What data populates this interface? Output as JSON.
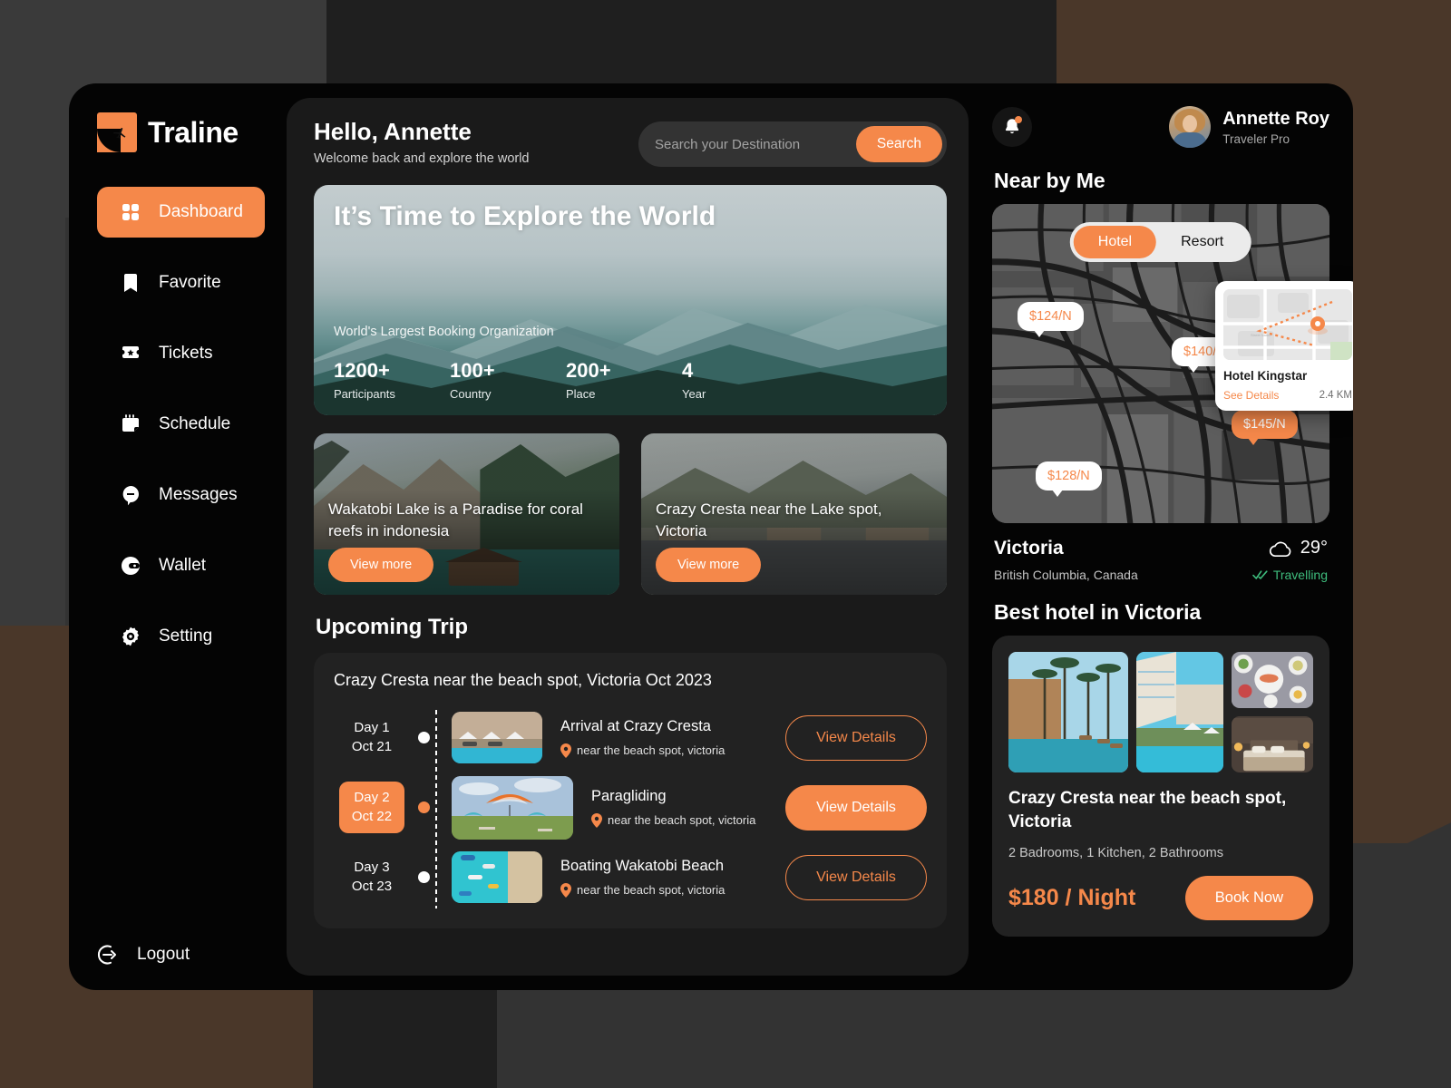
{
  "brand": {
    "name": "Traline",
    "logo_icon": "plane-logo-icon"
  },
  "sidebar": {
    "items": [
      {
        "label": "Dashboard",
        "icon": "grid-icon",
        "active": true
      },
      {
        "label": "Favorite",
        "icon": "bookmark-icon",
        "active": false
      },
      {
        "label": "Tickets",
        "icon": "ticket-star-icon",
        "active": false
      },
      {
        "label": "Schedule",
        "icon": "calendar-icon",
        "active": false
      },
      {
        "label": "Messages",
        "icon": "chat-bubble-icon",
        "active": false
      },
      {
        "label": "Wallet",
        "icon": "wallet-icon",
        "active": false
      },
      {
        "label": "Setting",
        "icon": "gear-icon",
        "active": false
      }
    ],
    "logout": {
      "label": "Logout",
      "icon": "power-icon"
    }
  },
  "header": {
    "greeting": "Hello, Annette",
    "subtitle": "Welcome back and explore the world",
    "search_placeholder": "Search your Destination",
    "search_value": "",
    "search_button": "Search"
  },
  "hero": {
    "title": "It’s Time to Explore the World",
    "subtitle": "World's Largest Booking Organization",
    "stats": [
      {
        "value": "1200+",
        "label": "Participants"
      },
      {
        "value": "100+",
        "label": "Country"
      },
      {
        "value": "200+",
        "label": "Place"
      },
      {
        "value": "4",
        "label": "Year"
      }
    ]
  },
  "destinations": [
    {
      "title": "Wakatobi Lake is a Paradise for coral reefs in indonesia",
      "button": "View more"
    },
    {
      "title": "Crazy Cresta near the Lake spot, Victoria",
      "button": "View more"
    }
  ],
  "upcoming": {
    "section_title": "Upcoming Trip",
    "trip_title": "Crazy Cresta near the beach spot, Victoria Oct 2023",
    "rows": [
      {
        "day": "Day 1",
        "date": "Oct 21",
        "active": false,
        "name": "Arrival at Crazy Cresta",
        "location": "near the beach spot, victoria",
        "button": "View Details",
        "button_style": "outline"
      },
      {
        "day": "Day 2",
        "date": "Oct 22",
        "active": true,
        "name": "Paragliding",
        "location": "near the beach spot, victoria",
        "button": "View Details",
        "button_style": "solid"
      },
      {
        "day": "Day 3",
        "date": "Oct 23",
        "active": false,
        "name": "Boating Wakatobi Beach",
        "location": "near the beach spot, victoria",
        "button": "View Details",
        "button_style": "outline"
      }
    ]
  },
  "user": {
    "name": "Annette Roy",
    "role": "Traveler Pro",
    "notification_icon": "bell-icon",
    "has_notification": true
  },
  "nearby": {
    "section_title": "Near by Me",
    "tabs": [
      {
        "label": "Hotel",
        "active": true
      },
      {
        "label": "Resort",
        "active": false
      }
    ],
    "price_pins": [
      {
        "price": "$124/N",
        "accent": false
      },
      {
        "price": "$140/N",
        "accent": false
      },
      {
        "price": "$145/N",
        "accent": true
      },
      {
        "price": "$128/N",
        "accent": false
      }
    ],
    "popup": {
      "name": "Hotel Kingstar",
      "link": "See Details",
      "distance": "2.4 KM"
    }
  },
  "location": {
    "name": "Victoria",
    "region": "British Columbia, Canada",
    "temperature": "29°",
    "weather_icon": "cloud-icon",
    "status": "Travelling",
    "status_icon": "double-check-icon"
  },
  "best_hotel": {
    "section_title": "Best hotel in Victoria",
    "title": "Crazy Cresta near the beach spot, Victoria",
    "meta": "2 Badrooms,  1 Kitchen, 2 Bathrooms",
    "price": "$180 / Night",
    "book_button": "Book Now"
  },
  "colors": {
    "accent": "#f5884a",
    "panel": "#1a1a1a",
    "card": "#222222",
    "window": "#040404",
    "success": "#3ebd7d"
  }
}
